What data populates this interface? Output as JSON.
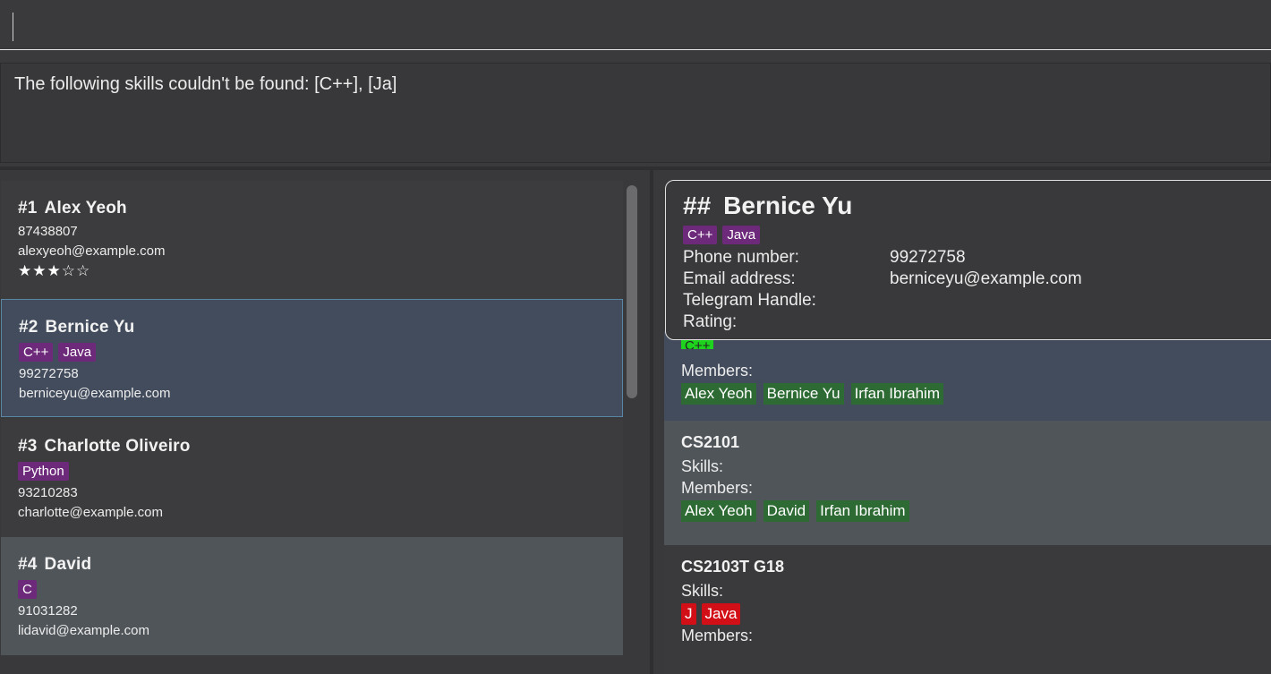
{
  "command": {
    "value": ""
  },
  "result": {
    "message": "The following skills couldn't be found: [C++], [Ja]"
  },
  "persons": [
    {
      "index": "#1",
      "name": "Alex Yeoh",
      "tags": [],
      "phone": "87438807",
      "email": "alexyeoh@example.com",
      "rating_stars": "★★★☆☆"
    },
    {
      "index": "#2",
      "name": "Bernice Yu",
      "tags": [
        "C++",
        "Java"
      ],
      "phone": "99272758",
      "email": "berniceyu@example.com"
    },
    {
      "index": "#3",
      "name": "Charlotte Oliveiro",
      "tags": [
        "Python"
      ],
      "phone": "93210283",
      "email": "charlotte@example.com"
    },
    {
      "index": "#4",
      "name": "David",
      "tags": [
        "C"
      ],
      "phone": "91031282",
      "email": "lidavid@example.com"
    }
  ],
  "popup": {
    "index": "##",
    "name": "Bernice Yu",
    "tags": [
      "C++",
      "Java"
    ],
    "phone_label": "Phone number:",
    "phone": "99272758",
    "email_label": "Email address:",
    "email": "berniceyu@example.com",
    "telegram_label": "Telegram Handle:",
    "telegram": "",
    "rating_label": "Rating:",
    "rating": ""
  },
  "groups": [
    {
      "partial_skill": "C++",
      "members_label": "Members:",
      "members": [
        "Alex Yeoh",
        "Bernice Yu",
        "Irfan Ibrahim"
      ]
    },
    {
      "name": "CS2101",
      "skills_label": "Skills:",
      "skills": [],
      "members_label": "Members:",
      "members": [
        "Alex Yeoh",
        "David",
        "Irfan Ibrahim"
      ]
    },
    {
      "name": "CS2103T G18",
      "skills_label": "Skills:",
      "skills": [
        "J",
        "Java"
      ],
      "members_label": "Members:",
      "members": []
    }
  ],
  "colors": {
    "person_tag": "#6d2a7a",
    "member_tag": "#2e6b34",
    "missing_skill_tag": "#d20f16",
    "found_skill_tag": "#1ed31e",
    "selected_card": "#424c5c"
  }
}
